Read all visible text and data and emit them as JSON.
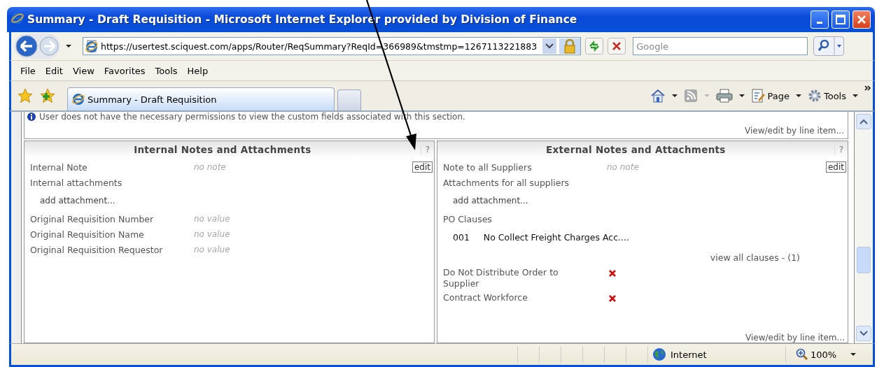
{
  "window": {
    "title": "Summary - Draft Requisition - Microsoft Internet Explorer provided by Division of Finance"
  },
  "address_bar": {
    "url": "https://usertest.sciquest.com/apps/Router/ReqSummary?ReqId=366989&tmstmp=1267113221883"
  },
  "search": {
    "placeholder": "Google"
  },
  "menu": [
    "File",
    "Edit",
    "View",
    "Favorites",
    "Tools",
    "Help"
  ],
  "tabs": [
    {
      "label": "Summary - Draft Requisition",
      "selected": true
    }
  ],
  "command_bar": [
    "Page",
    "Tools"
  ],
  "info_message": "User does not have the necessary permissions to view the custom fields associated with this section.",
  "top_link": "View/edit by line item...",
  "panels": [
    {
      "title": "Internal Notes and Attachments",
      "help": "?",
      "edit": "edit",
      "rows": [
        {
          "kind": "field",
          "label": "Internal Note",
          "value": "no note"
        },
        {
          "kind": "heading",
          "label": "Internal attachments"
        },
        {
          "kind": "link",
          "text": "add attachment..."
        },
        {
          "kind": "field",
          "label": "Original Requisition Number",
          "value": "no value"
        },
        {
          "kind": "field",
          "label": "Original Requisition Name",
          "value": "no value"
        },
        {
          "kind": "field",
          "label": "Original Requisition Requestor",
          "value": "no value"
        }
      ]
    },
    {
      "title": "External Notes and Attachments",
      "help": "?",
      "edit": "edit",
      "footer": "View/edit by line item...",
      "rows": [
        {
          "kind": "field",
          "label": "Note to all Suppliers",
          "value": "no note"
        },
        {
          "kind": "heading",
          "label": "Attachments for all suppliers"
        },
        {
          "kind": "link",
          "text": "add attachment..."
        },
        {
          "kind": "heading",
          "label": "PO Clauses"
        },
        {
          "kind": "clause",
          "number": "001",
          "text": "No Collect Freight Charges Acc...."
        },
        {
          "kind": "more",
          "text": "view all clauses - (1)"
        },
        {
          "kind": "flag",
          "label": "Do Not Distribute Order to Supplier",
          "checked": false
        },
        {
          "kind": "flag",
          "label": "Contract Workforce",
          "checked": false
        }
      ]
    }
  ],
  "status_bar": {
    "zone": "Internet",
    "zoom": "100%"
  }
}
